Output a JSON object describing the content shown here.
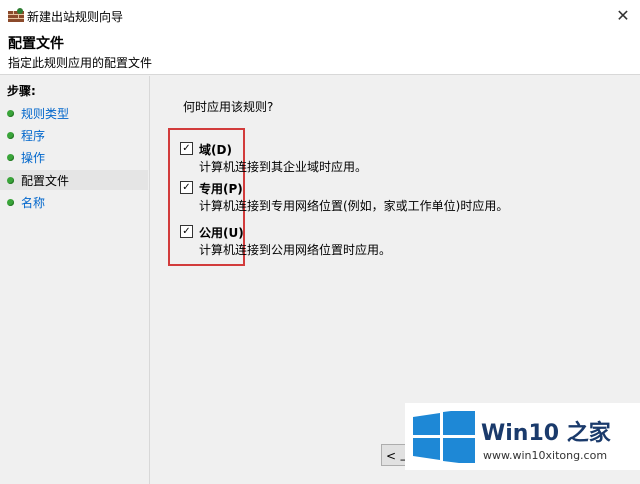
{
  "window": {
    "title": "新建出站规则向导",
    "close_glyph": "✕"
  },
  "header": {
    "title": "配置文件",
    "subtitle": "指定此规则应用的配置文件"
  },
  "steps": {
    "title": "步骤:",
    "items": [
      {
        "label": "规则类型"
      },
      {
        "label": "程序"
      },
      {
        "label": "操作"
      },
      {
        "label": "配置文件"
      },
      {
        "label": "名称"
      }
    ]
  },
  "content": {
    "question": "何时应用该规则?",
    "options": [
      {
        "label": "域(D)",
        "desc": "计算机连接到其企业域时应用。",
        "checked": true
      },
      {
        "label": "专用(P)",
        "desc": "计算机连接到专用网络位置(例如，家或工作单位)时应用。",
        "checked": true
      },
      {
        "label": "公用(U)",
        "desc": "计算机连接到公用网络位置时应用。",
        "checked": true
      }
    ],
    "back_button": "< 上"
  },
  "watermark": {
    "brand": "Win10 之家",
    "url": "www.win10xitong.com",
    "colors": {
      "logo": "#1e88d6",
      "brand": "#1a3a6b"
    }
  },
  "check_glyph": "✓"
}
